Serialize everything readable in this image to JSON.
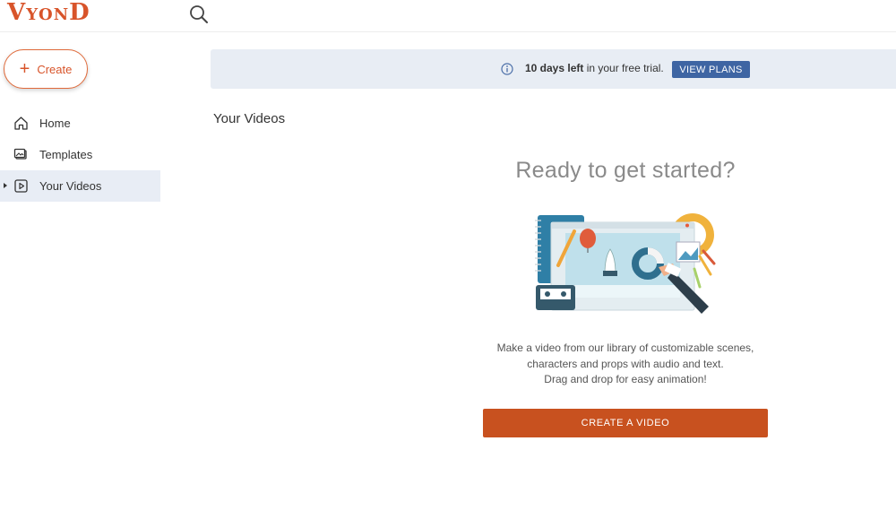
{
  "app": {
    "logo_text": "VYOND"
  },
  "sidebar": {
    "create_label": "Create",
    "items": [
      {
        "label": "Home",
        "icon": "home-icon",
        "active": false
      },
      {
        "label": "Templates",
        "icon": "templates-icon",
        "active": false
      },
      {
        "label": "Your Videos",
        "icon": "video-icon",
        "active": true
      }
    ]
  },
  "banner": {
    "days_left": "10 days left",
    "suffix": " in your free trial.",
    "button_label": "VIEW PLANS"
  },
  "main": {
    "title": "Your Videos",
    "empty_heading": "Ready to get started?",
    "description_lines": [
      "Make a video from our library of customizable scenes,",
      "characters and props with audio and text.",
      "Drag and drop for easy animation!"
    ],
    "cta_label": "CREATE A VIDEO"
  },
  "colors": {
    "brand": "#d8542a",
    "cta": "#c8511f",
    "banner_bg": "#e8edf4",
    "plans_button": "#3e65a3",
    "active_nav_bg": "#e8edf5"
  }
}
